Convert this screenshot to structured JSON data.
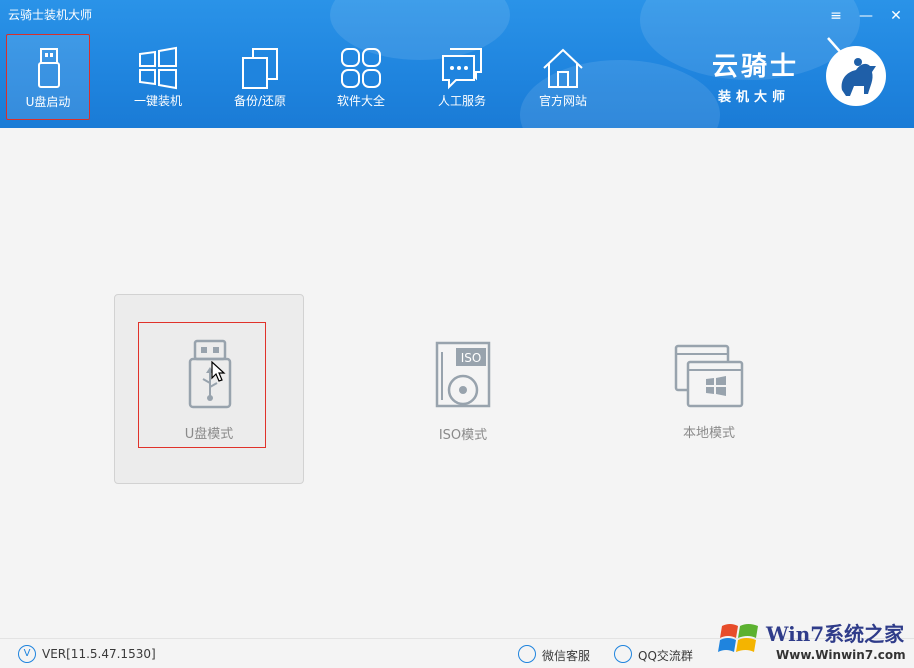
{
  "app": {
    "title": "云骑士装机大师"
  },
  "window_controls": {
    "menu": "≡",
    "minimize": "—",
    "close": "✕"
  },
  "nav": [
    {
      "label": "U盘启动",
      "icon": "usb-drive-icon",
      "active": true
    },
    {
      "label": "一键装机",
      "icon": "windows-icon",
      "active": false
    },
    {
      "label": "备份/还原",
      "icon": "backup-restore-icon",
      "active": false
    },
    {
      "label": "软件大全",
      "icon": "apps-grid-icon",
      "active": false
    },
    {
      "label": "人工服务",
      "icon": "chat-icon",
      "active": false
    },
    {
      "label": "官方网站",
      "icon": "home-icon",
      "active": false
    }
  ],
  "brand": {
    "title": "云骑士",
    "subtitle": "装机大师",
    "logo": "knight-logo-icon"
  },
  "modes": [
    {
      "label": "U盘模式",
      "icon": "usb-mode-icon",
      "selected": true
    },
    {
      "label": "ISO模式",
      "icon": "iso-disc-icon",
      "iso_tag": "ISO",
      "selected": false
    },
    {
      "label": "本地模式",
      "icon": "local-mode-icon",
      "selected": false
    }
  ],
  "footer": {
    "version_icon": "V",
    "version": "VER[11.5.47.1530]",
    "links": [
      {
        "label": "微信客服",
        "icon": "wechat-icon"
      },
      {
        "label": "QQ交流群",
        "icon": "qq-icon"
      }
    ]
  },
  "watermark": {
    "text": "Win7系统之家",
    "url": "Www.Winwin7.com"
  },
  "colors": {
    "header": "#1f84de",
    "accent_red": "#e0322a",
    "mode_gray": "#8a8a8a"
  }
}
